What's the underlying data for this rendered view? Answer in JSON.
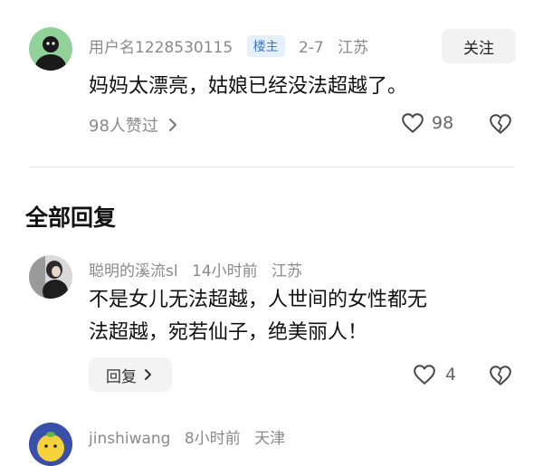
{
  "top_comment": {
    "username": "用户名1228530115",
    "badge": "楼主",
    "date": "2-7",
    "location": "江苏",
    "follow_label": "关注",
    "text": "妈妈太漂亮，姑娘已经没法超越了。",
    "likers": "98人赞过",
    "likes": "98"
  },
  "section_title": "全部回复",
  "replies": [
    {
      "username": "聪明的溪流sl",
      "time": "14小时前",
      "location": "江苏",
      "text_line1": "不是女儿无法超越，人世间的女性都无",
      "text_line2": "法超越，宛若仙子，绝美丽人！",
      "reply_label": "回复",
      "likes": "4"
    },
    {
      "username": "jinshiwang",
      "time": "8小时前",
      "location": "天津"
    }
  ],
  "icons": {
    "like": "heart-outline-icon",
    "dislike": "broken-heart-icon",
    "chevron": "chevron-right-icon"
  },
  "colors": {
    "badge_bg": "#e6f0fb",
    "badge_text": "#3b79c4",
    "meta_text": "#8a8a8a"
  }
}
